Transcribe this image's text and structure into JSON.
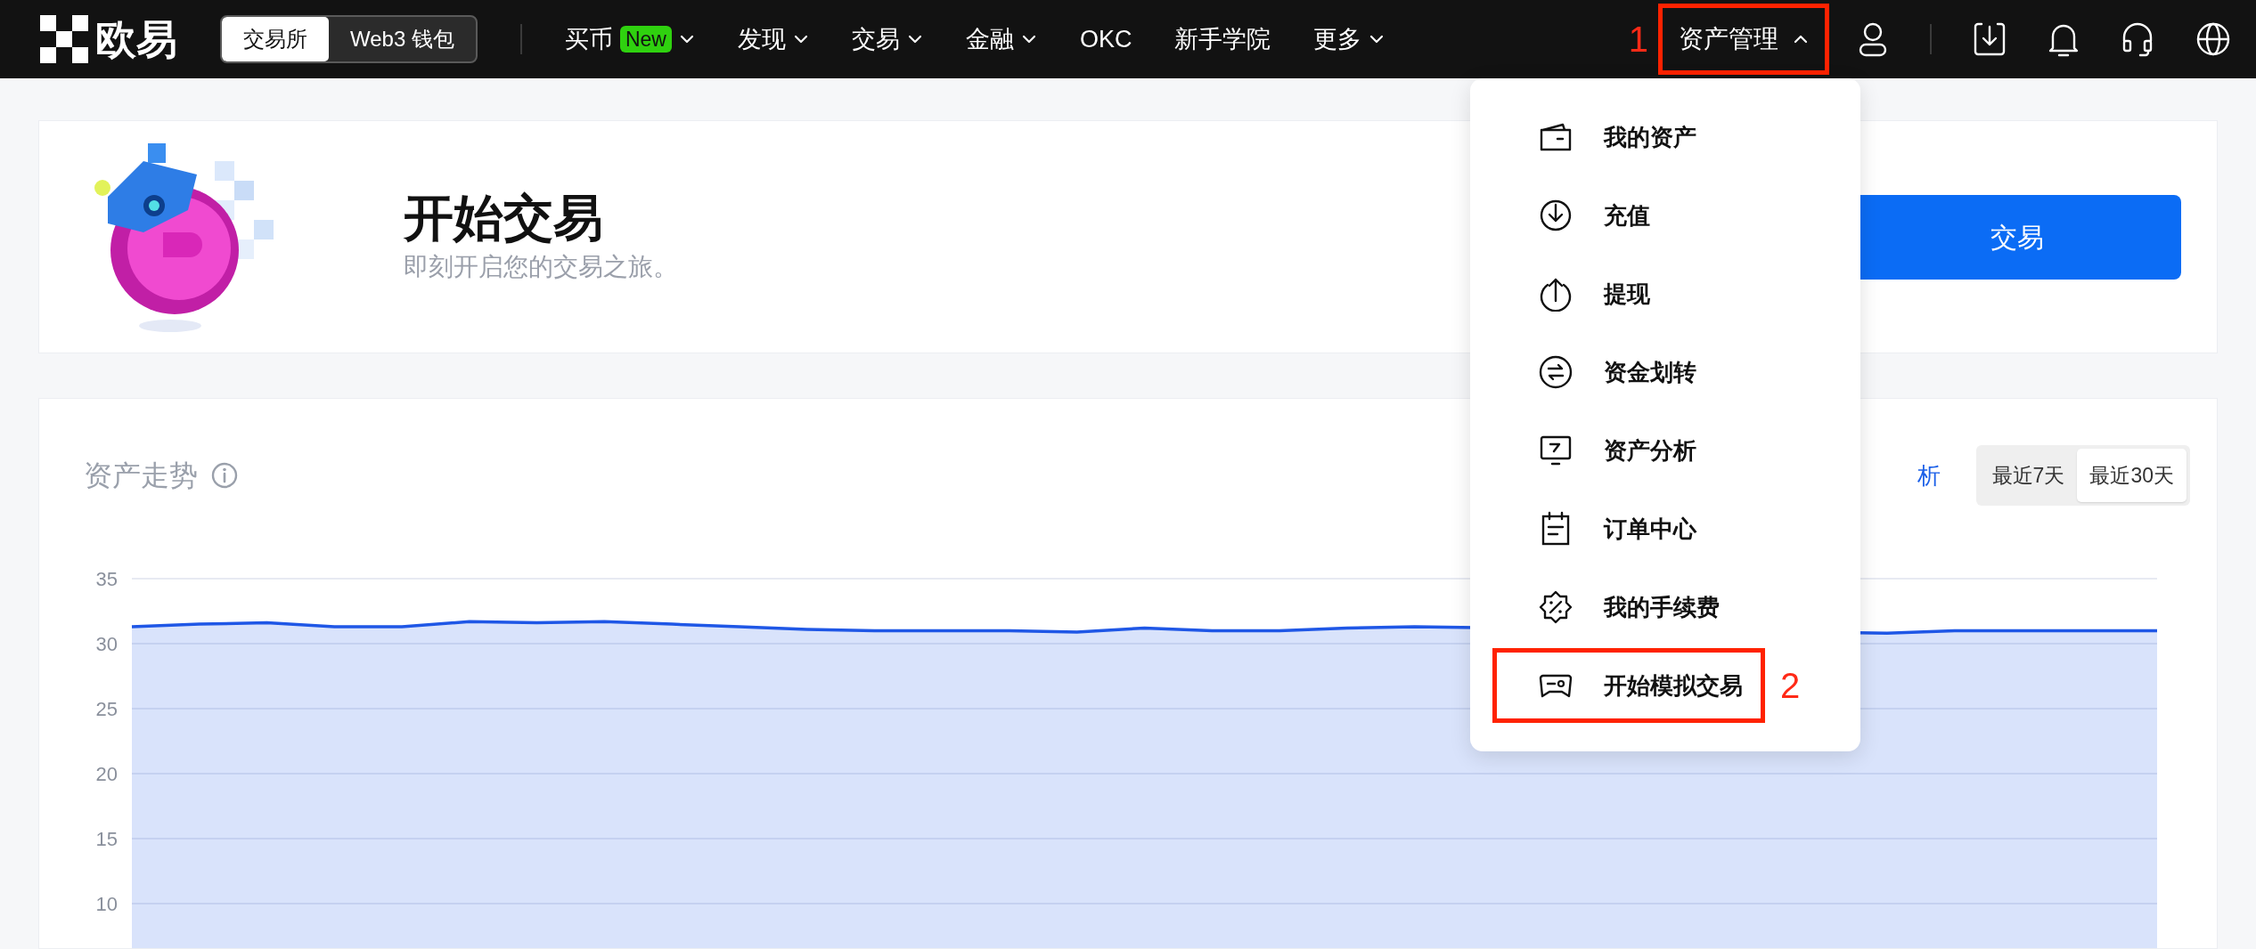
{
  "header": {
    "logo": "欧易",
    "switch": [
      {
        "label": "交易所",
        "selected": true
      },
      {
        "label": "Web3 钱包",
        "selected": false
      }
    ],
    "nav": [
      {
        "label": "买币",
        "badge": "New",
        "caret": true
      },
      {
        "label": "发现",
        "caret": true
      },
      {
        "label": "交易",
        "caret": true
      },
      {
        "label": "金融",
        "caret": true
      },
      {
        "label": "OKC",
        "caret": false
      },
      {
        "label": "新手学院",
        "caret": false
      },
      {
        "label": "更多",
        "caret": true
      }
    ],
    "asset_menu": {
      "label": "资产管理",
      "expanded": true,
      "highlighted": true,
      "marker": "1"
    }
  },
  "banner": {
    "title": "开始交易",
    "subtitle": "即刻开启您的交易之旅。",
    "button": "交易"
  },
  "asset_trend": {
    "title": "资产走势",
    "link": "析",
    "ranges": [
      {
        "label": "最近7天",
        "selected": false
      },
      {
        "label": "最近30天",
        "selected": true
      }
    ],
    "chart_data": {
      "type": "area",
      "categories": [
        null,
        null,
        null,
        null,
        null,
        null,
        null,
        null,
        null,
        null,
        null,
        null,
        null,
        null,
        null,
        null,
        null,
        null,
        null,
        null,
        null,
        null,
        null,
        null,
        null,
        null,
        null,
        null,
        null,
        null,
        null
      ],
      "ylim": [
        6.5,
        35
      ],
      "grid": true,
      "yticks": [
        10,
        15,
        20,
        25,
        30,
        35
      ],
      "series": [
        {
          "color": "#1f57e6",
          "values": [
            31.3,
            31.5,
            31.6,
            31.3,
            31.3,
            31.7,
            31.6,
            31.7,
            31.5,
            31.3,
            31.1,
            31.0,
            31.0,
            31.0,
            30.9,
            31.2,
            31.0,
            31.0,
            31.2,
            31.3,
            null,
            null,
            null,
            null,
            null,
            null,
            30.8,
            31.0,
            31.0,
            31.0,
            31.0
          ]
        }
      ]
    }
  },
  "dropdown": {
    "items": [
      {
        "label": "我的资产",
        "highlighted": false
      },
      {
        "label": "充值",
        "highlighted": false
      },
      {
        "label": "提现",
        "highlighted": false
      },
      {
        "label": "资金划转",
        "highlighted": false
      },
      {
        "label": "资产分析",
        "highlighted": false
      },
      {
        "label": "订单中心",
        "highlighted": false
      },
      {
        "label": "我的手续费",
        "highlighted": false
      },
      {
        "label": "开始模拟交易",
        "highlighted": true,
        "marker": "2"
      }
    ]
  }
}
